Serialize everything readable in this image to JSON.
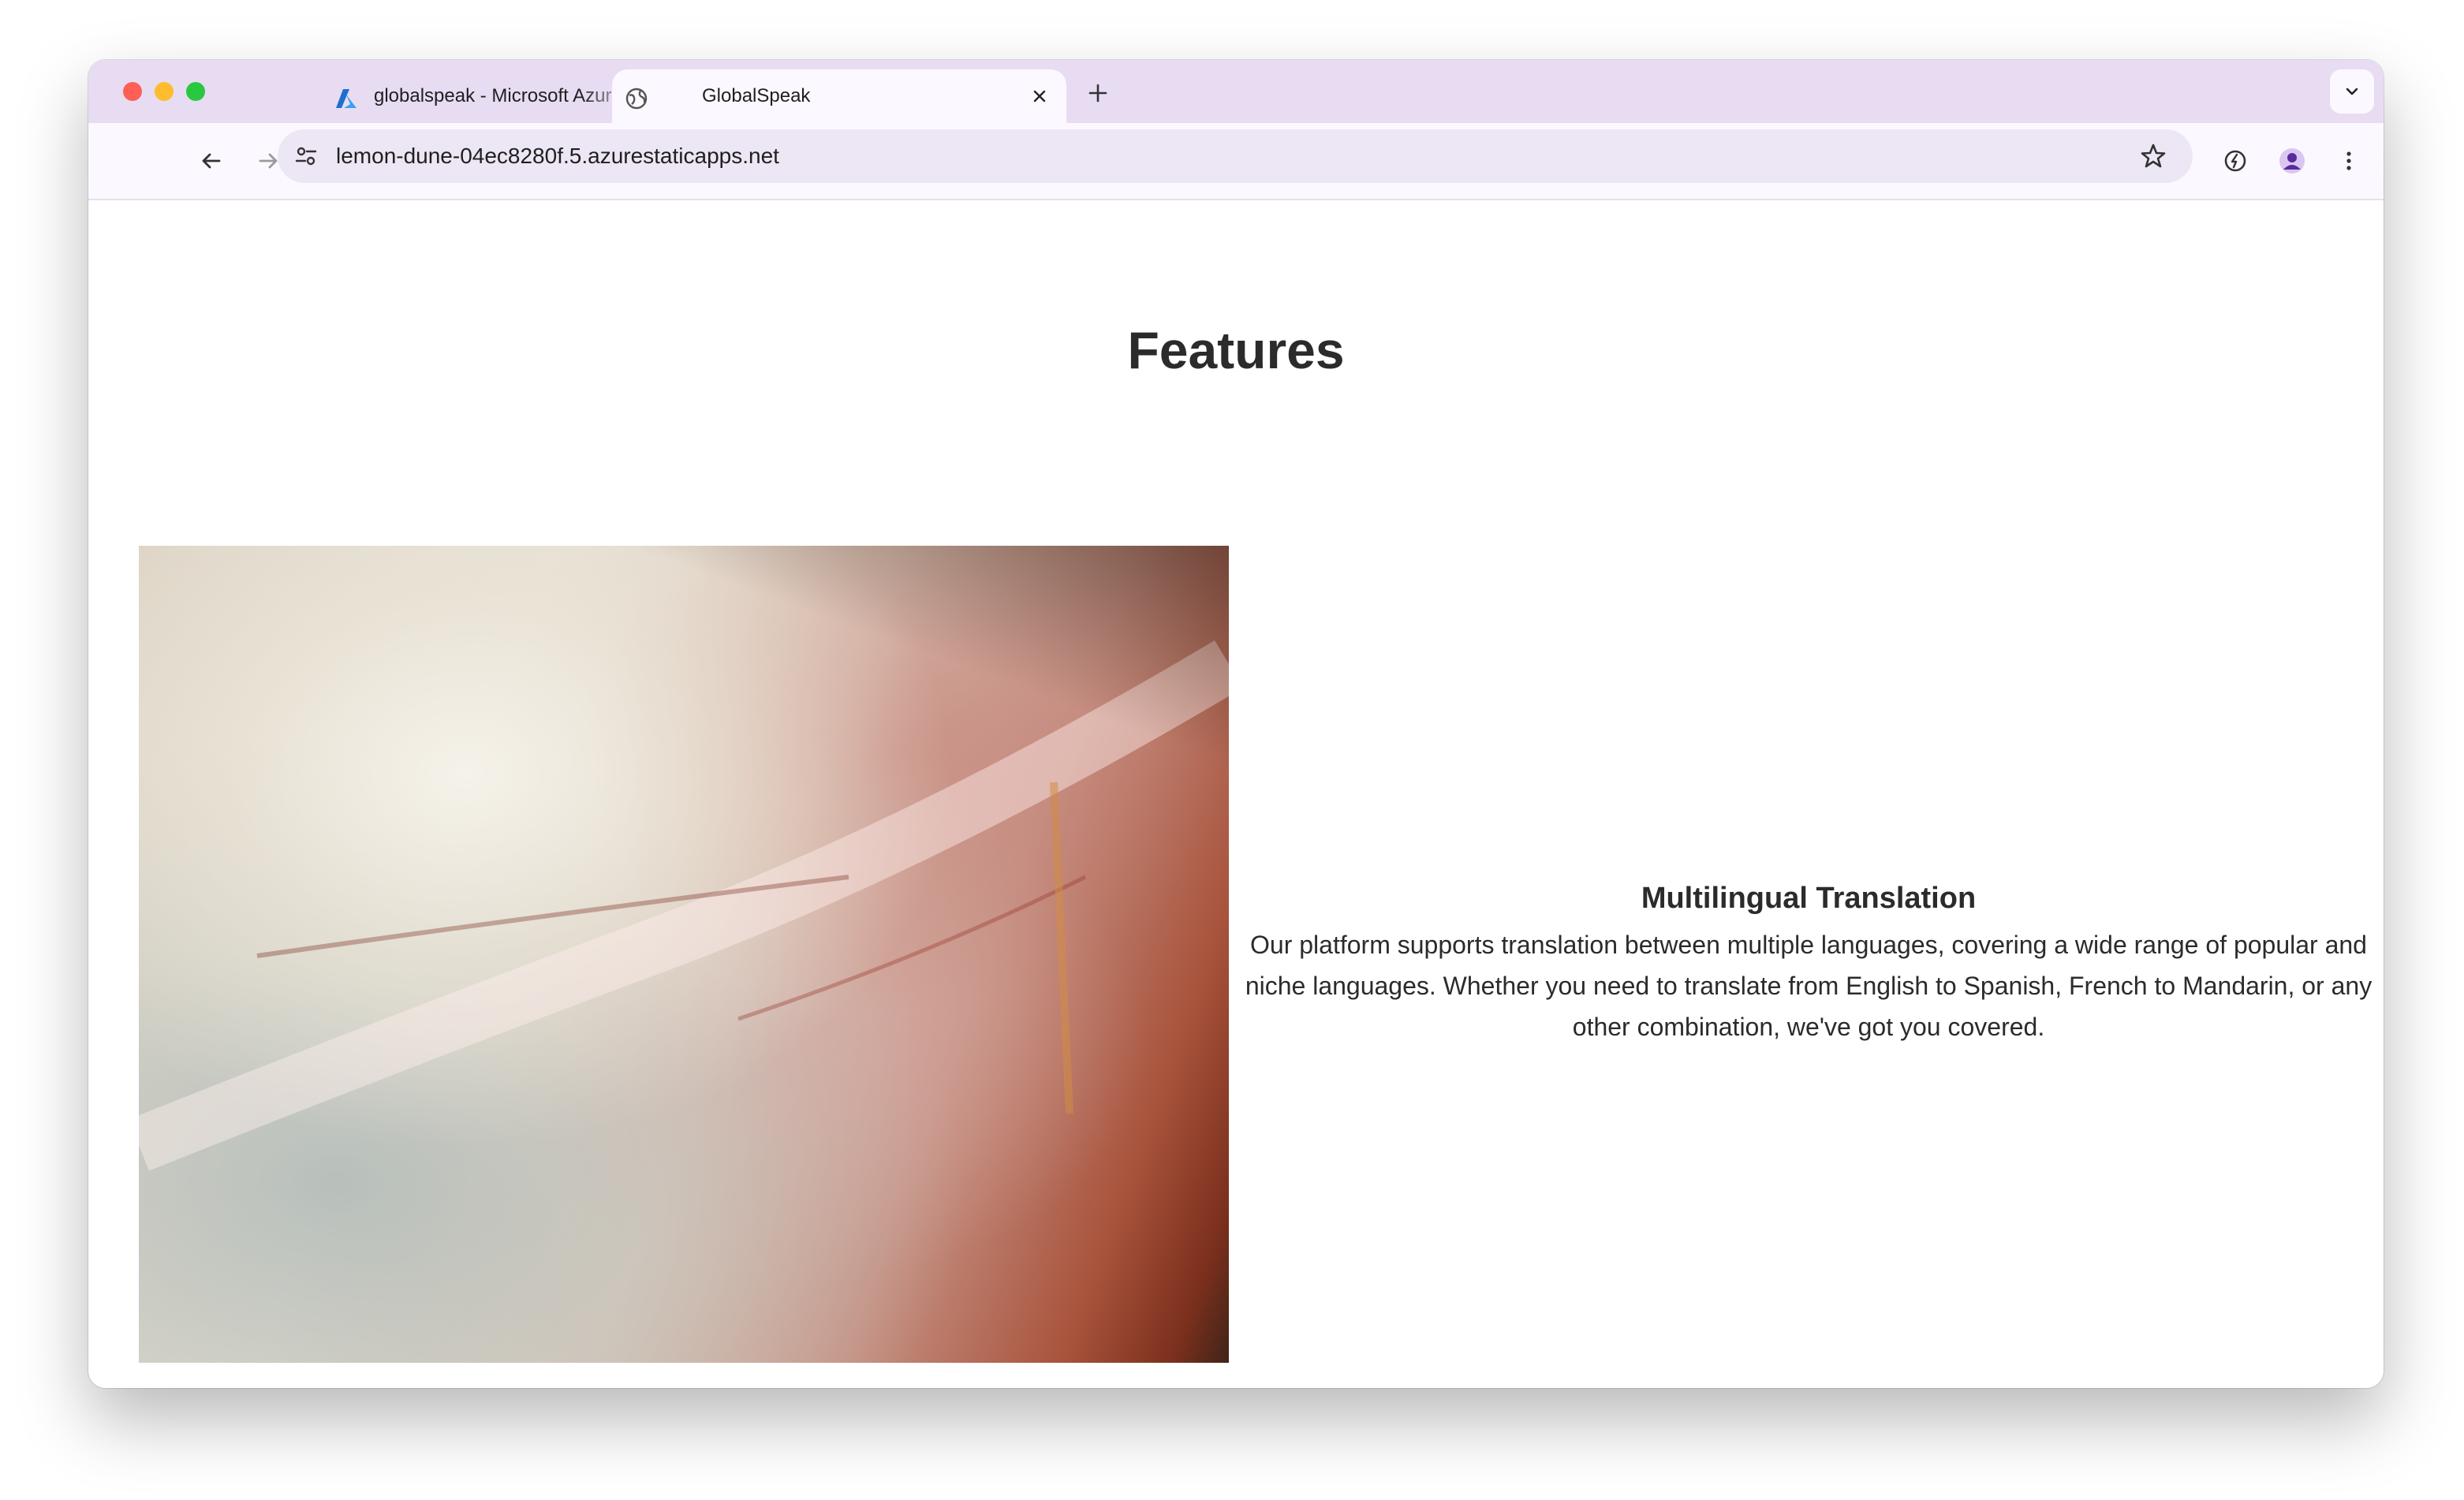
{
  "browser": {
    "tabs": [
      {
        "title": "globalspeak - Microsoft Azure",
        "active": false,
        "favicon": "azure-logo-icon"
      },
      {
        "title": "GlobalSpeak",
        "active": true,
        "favicon": "globe-icon"
      }
    ],
    "address_bar": {
      "url": "lemon-dune-04ec8280f.5.azurestaticapps.net"
    },
    "colors": {
      "tabstrip": "#e8dcf3",
      "toolbar": "#fcf8ff",
      "omnibox": "#ede6f4"
    }
  },
  "page": {
    "heading": "Features",
    "feature": {
      "title": "Multilingual Translation",
      "description": "Our platform supports translation between multiple languages, covering a wide range of popular and niche languages. Whether you need to translate from English to Spanish, French to Mandarin, or any other combination, we've got you covered."
    }
  }
}
